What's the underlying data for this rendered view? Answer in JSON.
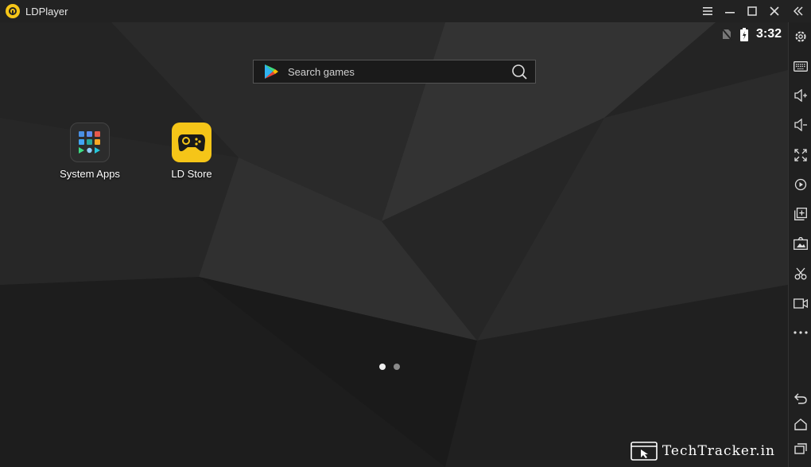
{
  "window": {
    "title": "LDPlayer",
    "controls": [
      "menu-icon",
      "minimize-icon",
      "maximize-icon",
      "close-icon",
      "collapse-icon"
    ]
  },
  "status_bar": {
    "time": "3:32",
    "icons": [
      "no-sim-icon",
      "battery-charging-icon"
    ]
  },
  "search": {
    "placeholder": "Search games"
  },
  "apps": [
    {
      "label": "System Apps",
      "icon": "system-apps-folder-icon"
    },
    {
      "label": "LD Store",
      "icon": "gamepad-icon"
    }
  ],
  "pager": {
    "pages": 2,
    "current": 1
  },
  "sidebar": {
    "tools": [
      "settings-icon",
      "keyboard-icon",
      "volume-up-icon",
      "volume-down-icon",
      "fullscreen-icon",
      "record-icon",
      "add-app-icon",
      "screenshot-icon",
      "scissors-icon",
      "video-icon",
      "more-icon",
      "back-icon",
      "home-icon",
      "recents-icon"
    ]
  },
  "watermark": {
    "text": "TechTracker.in"
  },
  "colors": {
    "brand": "#f5c518",
    "background": "#232323",
    "toolbar": "#202020"
  }
}
